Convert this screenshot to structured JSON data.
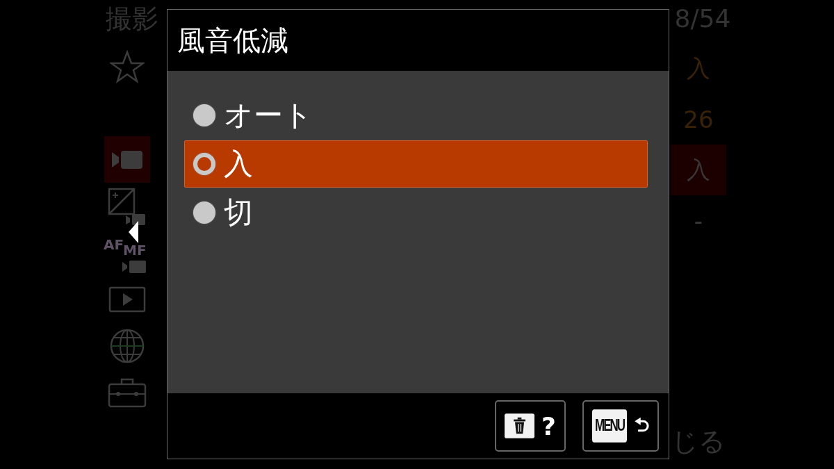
{
  "background_menu": {
    "breadcrumb": "撮影",
    "page_counter": "8/54",
    "tabs": [
      {
        "kind": "star",
        "selected": false
      },
      {
        "kind": "movie",
        "selected": true
      },
      {
        "kind": "exposure-movie",
        "selected": false
      },
      {
        "kind": "af-mf",
        "selected": false,
        "labels": [
          "AF",
          "MF"
        ]
      },
      {
        "kind": "play",
        "selected": false
      },
      {
        "kind": "globe",
        "selected": false
      },
      {
        "kind": "toolbox",
        "selected": false
      }
    ],
    "values": [
      {
        "text": "入",
        "kind": "accent",
        "selected": false
      },
      {
        "text": "26",
        "kind": "accent",
        "selected": false
      },
      {
        "text": "入",
        "kind": "plain",
        "selected": true
      },
      {
        "text": "-",
        "kind": "plain",
        "selected": false
      }
    ],
    "footer_hint": "じる"
  },
  "dialog": {
    "title": "風音低減",
    "options": [
      {
        "label": "オート",
        "selected": false
      },
      {
        "label": "入",
        "selected": true
      },
      {
        "label": "切",
        "selected": false
      }
    ],
    "buttons": [
      {
        "kind": "delete-help",
        "label": "?"
      },
      {
        "kind": "menu-back",
        "label": "MENU"
      }
    ]
  }
}
